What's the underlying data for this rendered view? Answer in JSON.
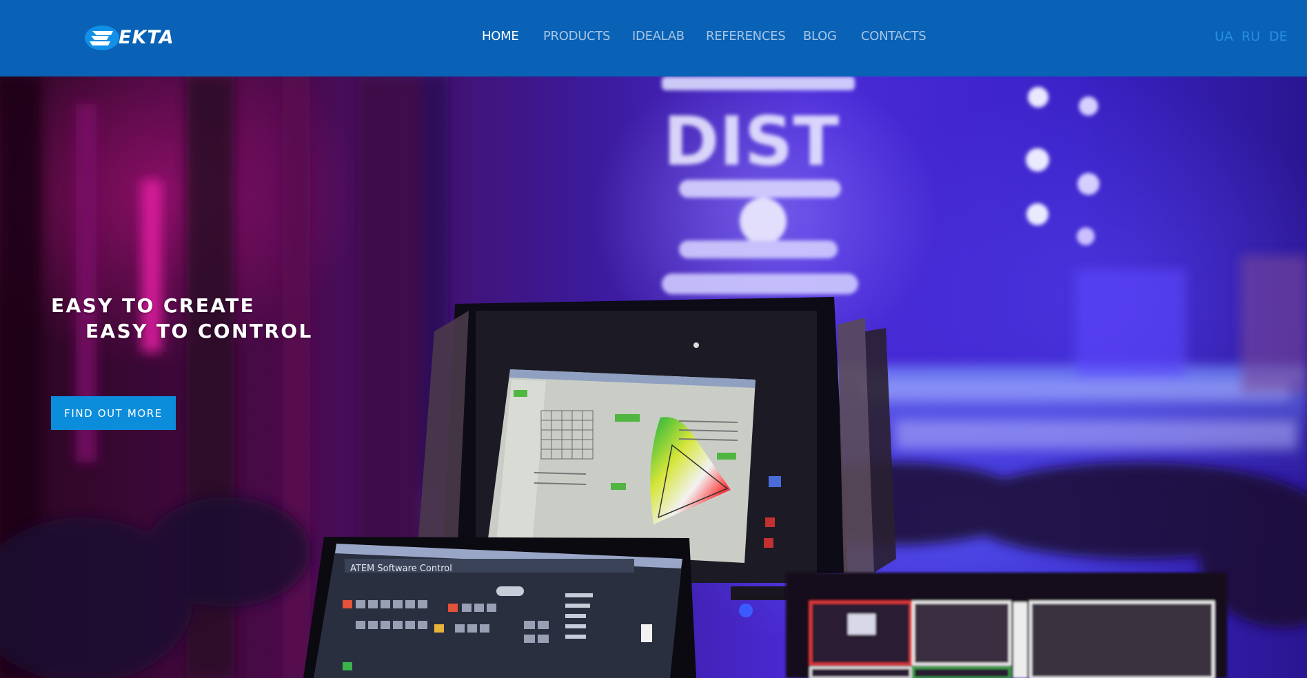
{
  "brand": {
    "name": "EKTA"
  },
  "nav": {
    "items": [
      {
        "label": "HOME",
        "active": true
      },
      {
        "label": "PRODUCTS",
        "active": false
      },
      {
        "label": "IDEALAB",
        "active": false
      },
      {
        "label": "REFERENCES",
        "active": false
      },
      {
        "label": "BLOG",
        "active": false
      },
      {
        "label": "CONTACTS",
        "active": false
      }
    ]
  },
  "languages": [
    "UA",
    "RU",
    "DE"
  ],
  "hero": {
    "title_line1": "EASY TO CREATE",
    "title_line2": "EASY TO CONTROL",
    "cta_label": "FIND OUT MORE",
    "screen_label": "ATEM Software Control",
    "stage_text": "DIST"
  },
  "colors": {
    "header_bg": "#0962b5",
    "nav_active": "#ffffff",
    "nav_inactive": "#a6c4e6",
    "lang": "#2a8de4",
    "cta_bg": "#0b8ddb"
  }
}
